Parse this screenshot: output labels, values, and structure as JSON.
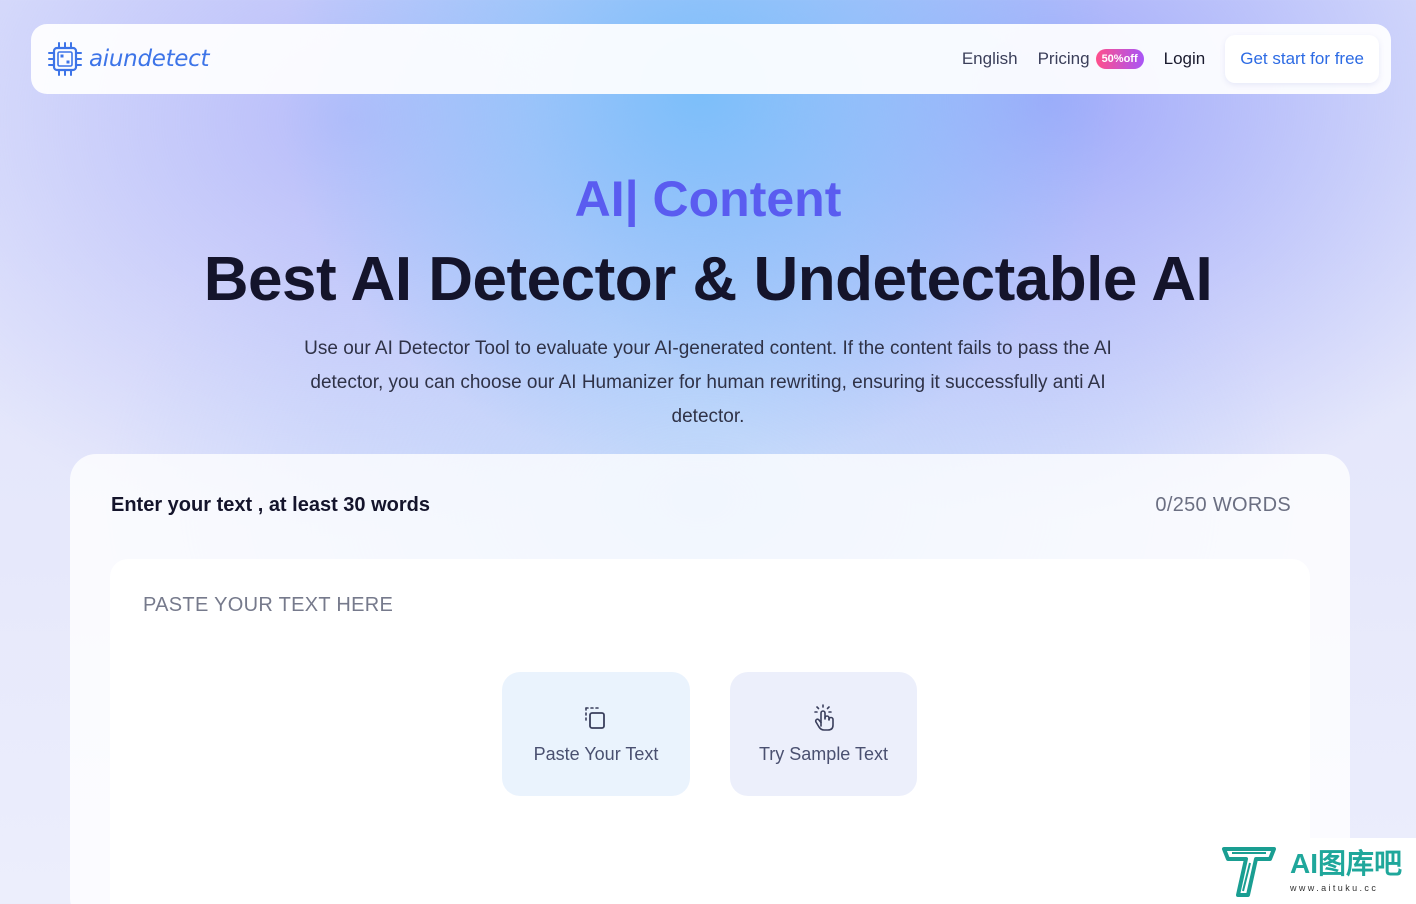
{
  "nav": {
    "brand": "aiundetect",
    "language": "English",
    "pricing": "Pricing",
    "pricing_badge": "50%off",
    "login": "Login",
    "cta": "Get start for free"
  },
  "hero": {
    "tag": "AI| Content",
    "title": "Best AI Detector & Undetectable AI",
    "description": "Use our AI Detector Tool to evaluate your AI-generated content. If the content fails to pass the AI detector, you can choose our AI Humanizer for human rewriting, ensuring it successfully anti AI detector."
  },
  "panel": {
    "label": "Enter your text , at least 30 words",
    "word_count": "0/250 WORDS",
    "placeholder": "PASTE YOUR TEXT HERE",
    "paste_button": "Paste Your Text",
    "sample_button": "Try Sample Text"
  },
  "watermark": {
    "title": "AI图库吧",
    "url": "www.aituku.cc"
  },
  "colors": {
    "brand": "#3d74e8",
    "accent": "#5a5cf0",
    "cta_text": "#2d6be4",
    "watermark": "#1fa79b"
  }
}
